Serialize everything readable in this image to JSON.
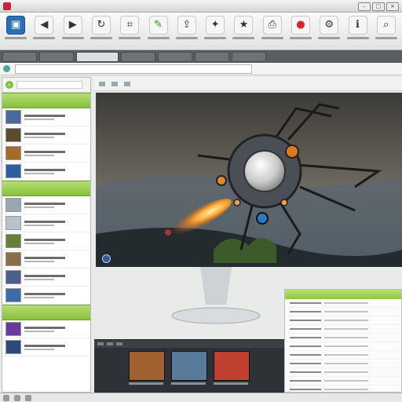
{
  "titlebar": {
    "title": "",
    "icon": "app-logo-icon"
  },
  "toolbar": {
    "tools": [
      {
        "name": "open-tool",
        "icon": "folder-icon",
        "glyph": "▣",
        "style": "blue"
      },
      {
        "name": "back-tool",
        "icon": "back-icon",
        "glyph": "◀",
        "style": ""
      },
      {
        "name": "forward-tool",
        "icon": "forward-icon",
        "glyph": "▶",
        "style": ""
      },
      {
        "name": "rotate-tool",
        "icon": "rotate-icon",
        "glyph": "↻",
        "style": ""
      },
      {
        "name": "crop-tool",
        "icon": "crop-icon",
        "glyph": "⌗",
        "style": ""
      },
      {
        "name": "edit-tool",
        "icon": "pencil-icon",
        "glyph": "✎",
        "style": "green"
      },
      {
        "name": "share-tool",
        "icon": "share-icon",
        "glyph": "⇪",
        "style": ""
      },
      {
        "name": "tag-tool",
        "icon": "tag-icon",
        "glyph": "✦",
        "style": ""
      },
      {
        "name": "star-tool",
        "icon": "star-icon",
        "glyph": "★",
        "style": ""
      },
      {
        "name": "print-tool",
        "icon": "print-icon",
        "glyph": "⎙",
        "style": ""
      },
      {
        "name": "record-tool",
        "icon": "record-icon",
        "glyph": "●",
        "style": "red"
      },
      {
        "name": "settings-tool",
        "icon": "gear-icon",
        "glyph": "⚙",
        "style": ""
      },
      {
        "name": "info-tool",
        "icon": "info-icon",
        "glyph": "ℹ",
        "style": ""
      },
      {
        "name": "zoom-tool",
        "icon": "magnifier-icon",
        "glyph": "⌕",
        "style": ""
      }
    ]
  },
  "tabs": [
    "",
    "",
    "",
    "",
    "",
    "",
    ""
  ],
  "sidebar": {
    "search_placeholder": "",
    "groups": [
      {
        "label": "",
        "items": [
          {
            "thumb": "#4a6b9a"
          },
          {
            "thumb": "#5b4a2e"
          },
          {
            "thumb": "#a56b2c"
          },
          {
            "thumb": "#2d5fa0"
          }
        ]
      },
      {
        "label": "",
        "items": [
          {
            "thumb": "#9aa7b0"
          },
          {
            "thumb": "#b8c3cd"
          },
          {
            "thumb": "#6b7d3a"
          },
          {
            "thumb": "#8a6e4a"
          },
          {
            "thumb": "#4c5e8a"
          },
          {
            "thumb": "#3d6aa8"
          }
        ]
      },
      {
        "label": "",
        "items": [
          {
            "thumb": "#6a3a9a"
          },
          {
            "thumb": "#2a4a7a"
          }
        ]
      }
    ]
  },
  "viewer": {
    "title": "",
    "subtitle": ""
  },
  "accent": "#86c23a",
  "filmstrip": {
    "thumbs": [
      "#a06030",
      "#5a7a9a",
      "#c04030"
    ]
  }
}
